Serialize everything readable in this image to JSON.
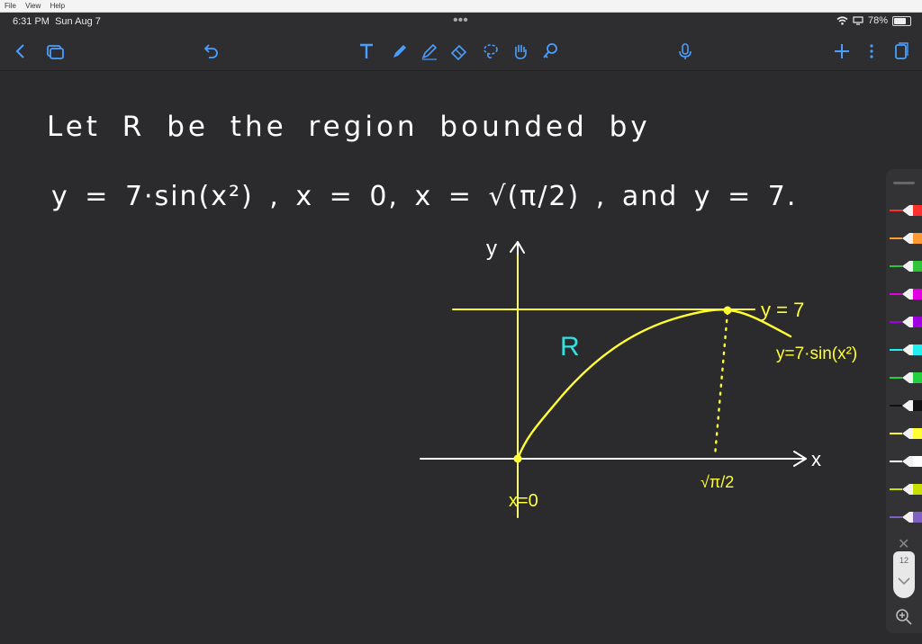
{
  "menubar": {
    "items": [
      "File",
      "View",
      "Help"
    ]
  },
  "status": {
    "time": "6:31 PM",
    "date": "Sun Aug 7",
    "more": "•••",
    "battery": "78%",
    "battery_level": 0.78
  },
  "toolbar": {
    "icons": [
      "back-icon",
      "pages-icon",
      "undo-icon",
      "text-tool-icon",
      "pen-tool-icon",
      "highlighter-icon",
      "eraser-icon",
      "lasso-icon",
      "hand-icon",
      "link-icon",
      "microphone-icon",
      "add-icon",
      "more-icon",
      "pages-view-icon"
    ],
    "accent": "#4a9eff"
  },
  "note": {
    "line1": "Let R be the region bounded by",
    "line2": "y = 7·sin(x²) ,  x = 0,  x = √(π/2) , and  y = 7.",
    "graph": {
      "y_axis_label": "y",
      "x_axis_label": "x",
      "region_label": "R",
      "line_label": "y = 7",
      "curve_label": "y=7·sin(x²)",
      "x_tick_label": "√π/2",
      "origin_label": "x=0",
      "ink_color": "#ffff33",
      "text_color": "#ffffff",
      "region_color": "#35e0e0"
    }
  },
  "palette": {
    "colors": [
      "#ff3030",
      "#ff9a30",
      "#2fc43a",
      "#e000e0",
      "#a000e0",
      "#22f0f0",
      "#22d040",
      "#111111",
      "#ffff33",
      "#ffffff",
      "#c8e000",
      "#8060c0"
    ],
    "page_count": "12"
  }
}
